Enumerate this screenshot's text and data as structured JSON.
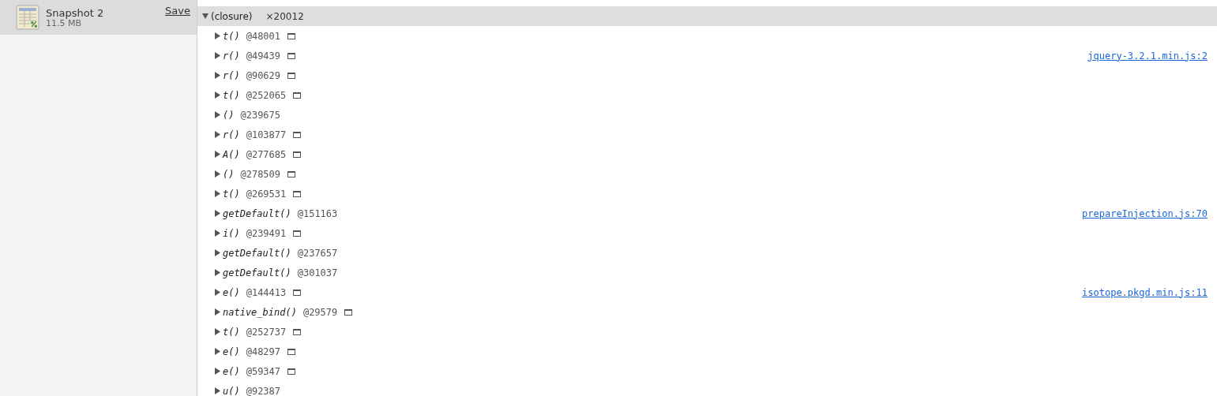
{
  "sidebar": {
    "snapshots": [
      {
        "title": "Snapshot 2",
        "size": "11.5 MB",
        "action": "Save",
        "selected": true
      }
    ]
  },
  "group": {
    "name": "(closure)",
    "count": "×20012",
    "expanded": true,
    "children": [
      {
        "name": "t()",
        "id": "@48001",
        "window_marker": true,
        "expanded": false
      },
      {
        "name": "r()",
        "id": "@49439",
        "window_marker": true,
        "expanded": false,
        "source": "jquery-3.2.1.min.js:2"
      },
      {
        "name": "r()",
        "id": "@90629",
        "window_marker": true,
        "expanded": false
      },
      {
        "name": "t()",
        "id": "@252065",
        "window_marker": true,
        "expanded": false
      },
      {
        "name": "()",
        "id": "@239675",
        "window_marker": false,
        "expanded": false
      },
      {
        "name": "r()",
        "id": "@103877",
        "window_marker": true,
        "expanded": false
      },
      {
        "name": "A()",
        "id": "@277685",
        "window_marker": true,
        "expanded": false
      },
      {
        "name": "()",
        "id": "@278509",
        "window_marker": true,
        "expanded": false
      },
      {
        "name": "t()",
        "id": "@269531",
        "window_marker": true,
        "expanded": false
      },
      {
        "name": "getDefault()",
        "id": "@151163",
        "window_marker": false,
        "expanded": false,
        "source": "prepareInjection.js:70"
      },
      {
        "name": "i()",
        "id": "@239491",
        "window_marker": true,
        "expanded": false
      },
      {
        "name": "getDefault()",
        "id": "@237657",
        "window_marker": false,
        "expanded": false
      },
      {
        "name": "getDefault()",
        "id": "@301037",
        "window_marker": false,
        "expanded": false
      },
      {
        "name": "e()",
        "id": "@144413",
        "window_marker": true,
        "expanded": false,
        "source": "isotope.pkgd.min.js:11"
      },
      {
        "name": "native_bind()",
        "id": "@29579",
        "window_marker": true,
        "expanded": false
      },
      {
        "name": "t()",
        "id": "@252737",
        "window_marker": true,
        "expanded": false
      },
      {
        "name": "e()",
        "id": "@48297",
        "window_marker": true,
        "expanded": false
      },
      {
        "name": "e()",
        "id": "@59347",
        "window_marker": true,
        "expanded": false
      },
      {
        "name": "u()",
        "id": "@92387",
        "window_marker": false,
        "expanded": false
      }
    ]
  }
}
